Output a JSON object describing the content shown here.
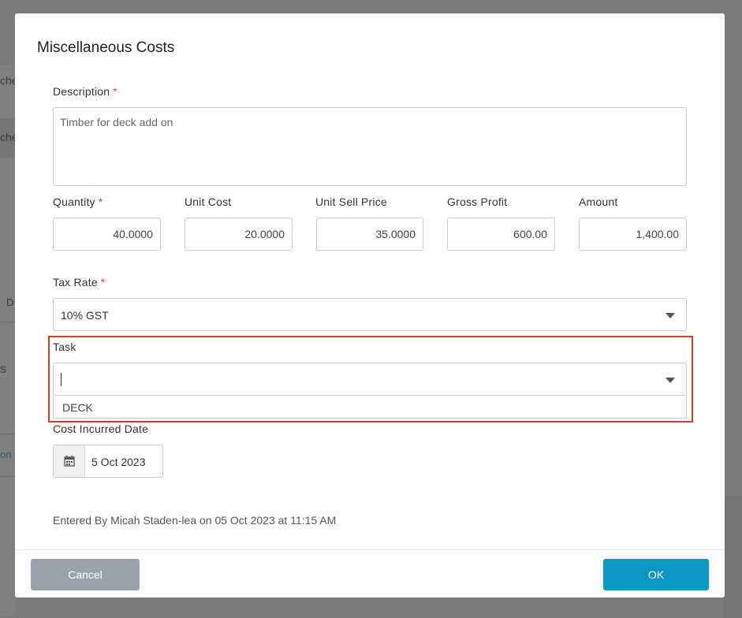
{
  "background": {
    "fragments": [
      "che",
      "che",
      "D",
      "s",
      "on"
    ]
  },
  "modal": {
    "title": "Miscellaneous Costs",
    "description": {
      "label": "Description",
      "required": "*",
      "value": "Timber for deck add on"
    },
    "quantity": {
      "label": "Quantity",
      "required": "*",
      "value": "40.0000"
    },
    "unit_cost": {
      "label": "Unit Cost",
      "value": "20.0000"
    },
    "unit_sell_price": {
      "label": "Unit Sell Price",
      "value": "35.0000"
    },
    "gross_profit": {
      "label": "Gross Profit",
      "value": "600.00"
    },
    "amount": {
      "label": "Amount",
      "value": "1,400.00"
    },
    "tax_rate": {
      "label": "Tax Rate",
      "required": "*",
      "value": "10% GST"
    },
    "task": {
      "label": "Task",
      "value": "",
      "options": [
        "DECK"
      ]
    },
    "cost_incurred_date": {
      "label": "Cost Incurred Date",
      "value": "5 Oct 2023",
      "icon": "calendar-icon"
    },
    "entered_by": "Entered By Micah Staden-lea on 05 Oct 2023 at 11:15 AM",
    "buttons": {
      "cancel": "Cancel",
      "ok": "OK"
    },
    "colors": {
      "ok": "#0a97c5",
      "cancel": "#98a2ab",
      "highlight": "#e8381a",
      "required": "#e03a3a"
    }
  }
}
